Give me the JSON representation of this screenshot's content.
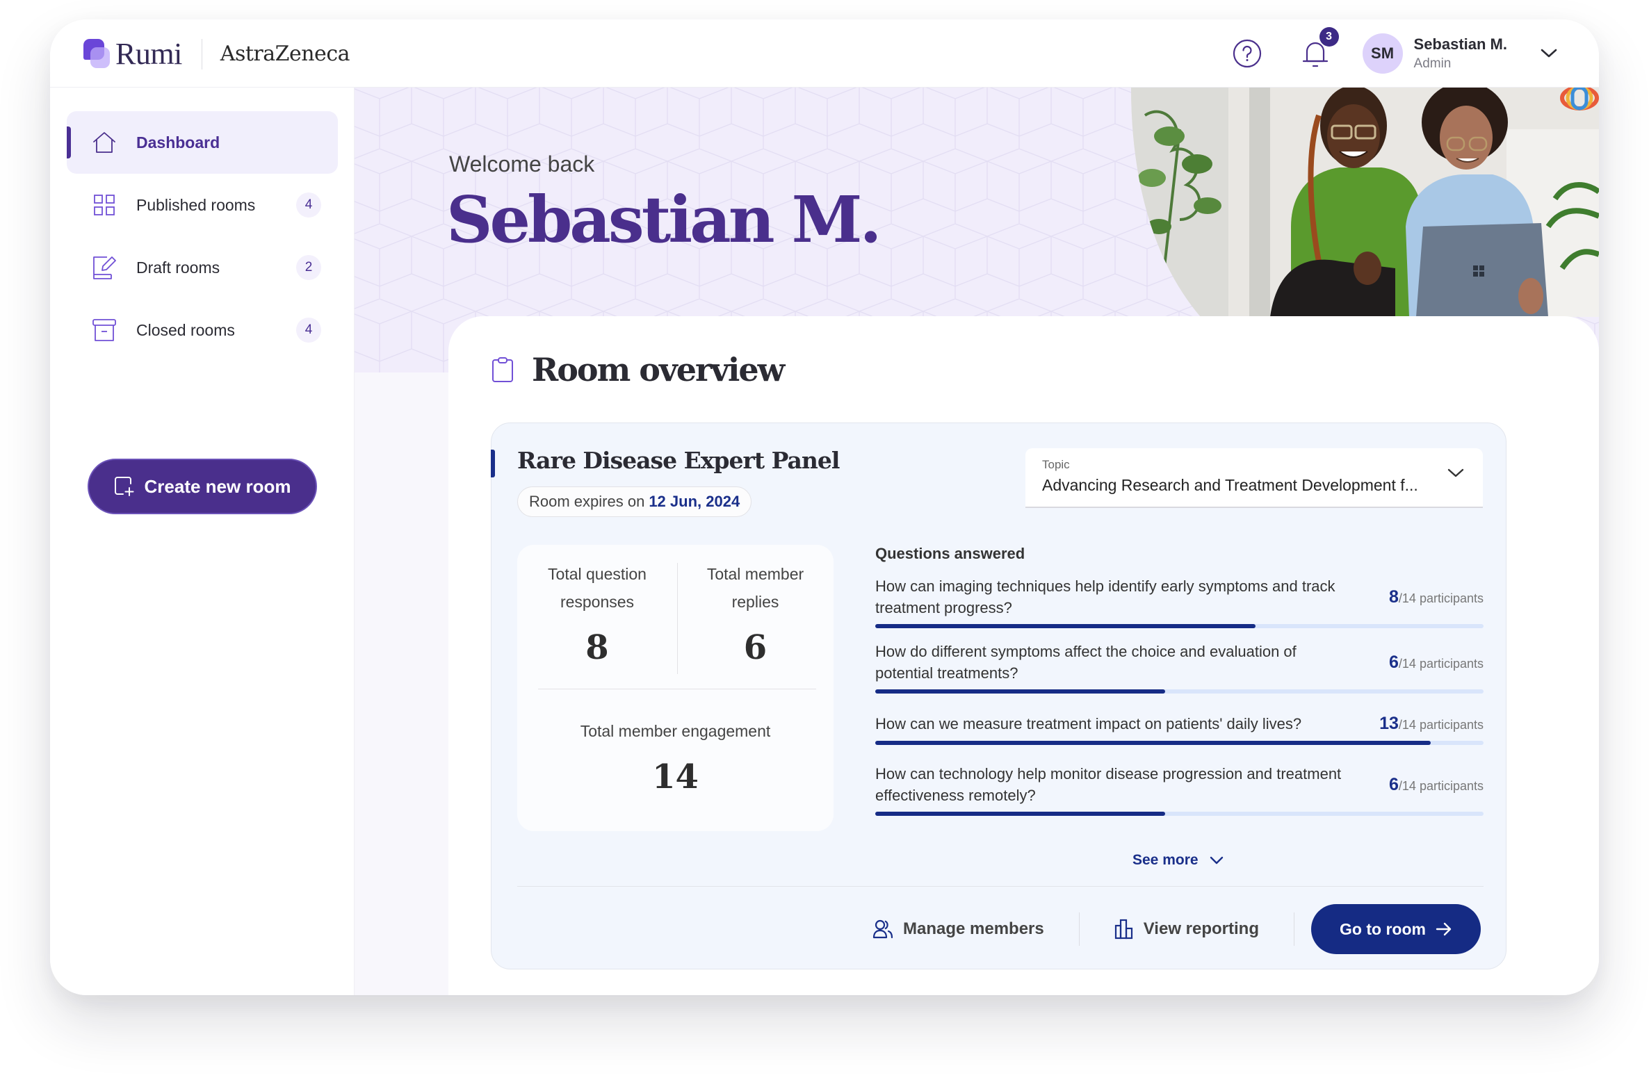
{
  "header": {
    "brand": "Rumi",
    "partner": "AstraZeneca",
    "notifications_count": "3",
    "user": {
      "initials": "SM",
      "name": "Sebastian M.",
      "role": "Admin"
    }
  },
  "sidebar": {
    "items": [
      {
        "label": "Dashboard",
        "icon": "home-icon",
        "active": true
      },
      {
        "label": "Published rooms",
        "icon": "grid-icon",
        "count": "4"
      },
      {
        "label": "Draft rooms",
        "icon": "edit-icon",
        "count": "2"
      },
      {
        "label": "Closed rooms",
        "icon": "archive-icon",
        "count": "4"
      }
    ],
    "create_button": "Create new room"
  },
  "hero": {
    "greeting": "Welcome back",
    "name": "Sebastian M."
  },
  "overview": {
    "title": "Room overview",
    "room": {
      "name": "Rare Disease Expert Panel",
      "expiry_prefix": "Room expires on",
      "expiry_date": "12 Jun, 2024",
      "topic_label": "Topic",
      "topic_value": "Advancing Research and Treatment Development f...",
      "stats": {
        "question_responses": {
          "label": "Total question responses",
          "value": "8"
        },
        "member_replies": {
          "label": "Total member replies",
          "value": "6"
        },
        "member_engagement": {
          "label": "Total member engagement",
          "value": "14"
        }
      },
      "questions_title": "Questions answered",
      "questions": [
        {
          "text": "How can imaging techniques help identify early symptoms and track treatment progress?",
          "answered": "8",
          "total": "14",
          "suffix": "/14 participants",
          "progress": 0.625
        },
        {
          "text": "How do different symptoms affect the choice and evaluation of potential treatments?",
          "answered": "6",
          "total": "14",
          "suffix": "/14 participants",
          "progress": 0.477
        },
        {
          "text": "How can we measure treatment impact on patients' daily lives?",
          "answered": "13",
          "total": "14",
          "suffix": "/14 participants",
          "progress": 0.913
        },
        {
          "text": "How can technology help monitor disease progression and treatment effectiveness remotely?",
          "answered": "6",
          "total": "14",
          "suffix": "/14 participants",
          "progress": 0.477
        }
      ],
      "see_more": "See more",
      "actions": {
        "manage_members": "Manage members",
        "view_reporting": "View reporting",
        "go_to_room": "Go to room"
      }
    }
  },
  "colors": {
    "brand_purple": "#4a2f8c",
    "accent_navy": "#152b84",
    "hero_bg": "#f1edfb",
    "room_bg": "#f2f6fd",
    "progress_track": "#d9e5fb"
  }
}
